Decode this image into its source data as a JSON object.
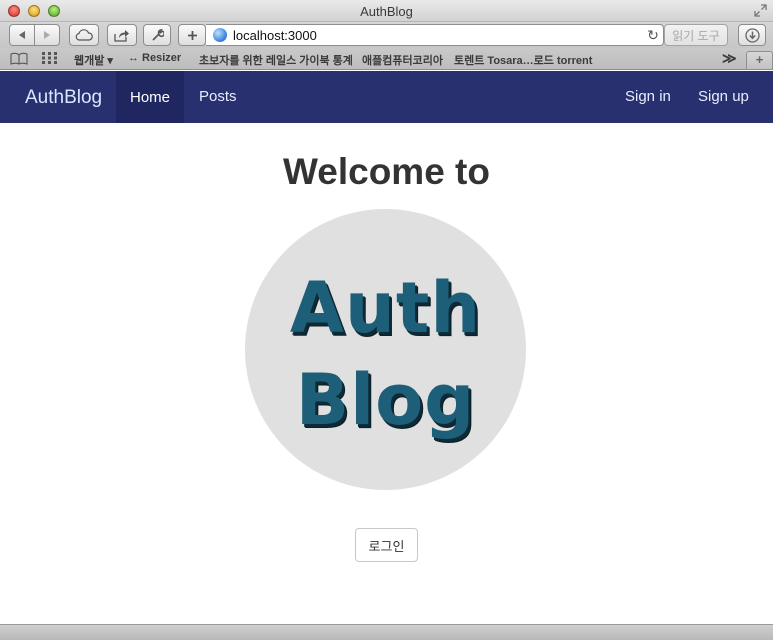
{
  "window": {
    "title": "AuthBlog"
  },
  "toolbar": {
    "url": "localhost:3000",
    "reader_label": "읽기 도구"
  },
  "bookmarks": {
    "items": [
      {
        "label": "웹개발 ▾"
      },
      {
        "label": "↔ Resizer"
      },
      {
        "label": "초보자를 위한 레일스 가이북 통계"
      },
      {
        "label": "애플컴퓨터코리아"
      },
      {
        "label": "토렌트 Tosara…로드 torrent"
      }
    ],
    "overflow_label": "≫",
    "new_tab_label": "+"
  },
  "navbar": {
    "brand": "AuthBlog",
    "links": [
      {
        "label": "Home"
      },
      {
        "label": "Posts"
      },
      {
        "label": "Sign in"
      },
      {
        "label": "Sign up"
      }
    ],
    "background": "#283070",
    "active_background": "#1f2660"
  },
  "main": {
    "heading": "Welcome to",
    "logo_lines": [
      "Auth",
      "Blog"
    ],
    "logo_color": "#1d5f78",
    "login_button": "로그인"
  }
}
